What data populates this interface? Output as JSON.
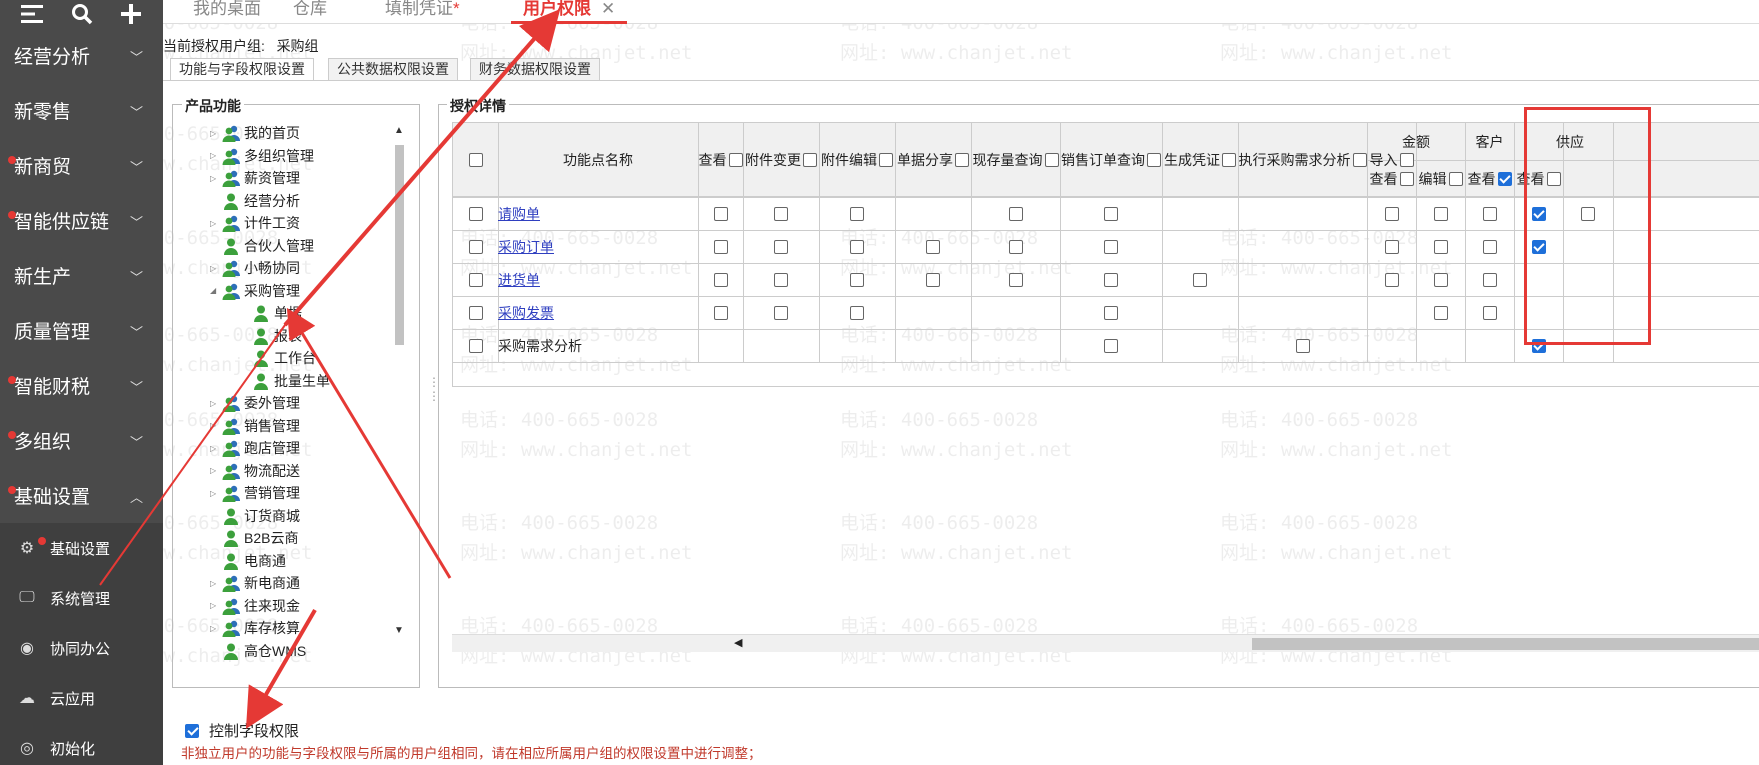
{
  "sidebar": {
    "items": [
      {
        "label": "经营分析",
        "dot": false,
        "chevron": "﹀"
      },
      {
        "label": "新零售",
        "dot": false,
        "chevron": "﹀"
      },
      {
        "label": "新商贸",
        "dot": true,
        "chevron": "﹀"
      },
      {
        "label": "智能供应链",
        "dot": true,
        "chevron": "﹀"
      },
      {
        "label": "新生产",
        "dot": false,
        "chevron": "﹀"
      },
      {
        "label": "质量管理",
        "dot": false,
        "chevron": "﹀"
      },
      {
        "label": "智能财税",
        "dot": true,
        "chevron": "﹀"
      },
      {
        "label": "多组织",
        "dot": true,
        "chevron": "﹀"
      },
      {
        "label": "基础设置",
        "dot": true,
        "chevron": "︿"
      }
    ],
    "sub_items": [
      {
        "label": "基础设置",
        "icon": "gear-icon",
        "dot": true
      },
      {
        "label": "系统管理",
        "icon": "monitor-icon",
        "dot": false
      },
      {
        "label": "协同办公",
        "icon": "chat-icon",
        "dot": false
      },
      {
        "label": "云应用",
        "icon": "cloud-icon",
        "dot": false
      },
      {
        "label": "初始化",
        "icon": "initialize-icon",
        "dot": false
      }
    ]
  },
  "tabs": [
    {
      "label": "我的桌面",
      "modified": ""
    },
    {
      "label": "仓库",
      "modified": ""
    },
    {
      "label": "填制凭证",
      "modified": "*"
    },
    {
      "label": "用户权限",
      "modified": "",
      "close": "✕"
    }
  ],
  "group": {
    "label": "当前授权用户组:",
    "value": "采购组"
  },
  "subtabs": [
    "功能与字段权限设置",
    "公共数据权限设置",
    "财务数据权限设置"
  ],
  "product_function": {
    "title": "产品功能",
    "items": [
      {
        "label": "我的首页",
        "expand": "▷",
        "icon": "group"
      },
      {
        "label": "多组织管理",
        "expand": "▷",
        "icon": "group"
      },
      {
        "label": "薪资管理",
        "expand": "▷",
        "icon": "group"
      },
      {
        "label": "经营分析",
        "expand": "",
        "icon": "user"
      },
      {
        "label": "计件工资",
        "expand": "▷",
        "icon": "group"
      },
      {
        "label": "合伙人管理",
        "expand": "",
        "icon": "user"
      },
      {
        "label": "小畅协同",
        "expand": "▷",
        "icon": "group"
      },
      {
        "label": "采购管理",
        "expand": "◢",
        "icon": "group"
      },
      {
        "label": "单据",
        "expand": "",
        "icon": "user",
        "indent": 1
      },
      {
        "label": "报表",
        "expand": "",
        "icon": "user",
        "indent": 1
      },
      {
        "label": "工作台",
        "expand": "",
        "icon": "user",
        "indent": 1
      },
      {
        "label": "批量生单",
        "expand": "",
        "icon": "user",
        "indent": 1
      },
      {
        "label": "委外管理",
        "expand": "▷",
        "icon": "group"
      },
      {
        "label": "销售管理",
        "expand": "▷",
        "icon": "group"
      },
      {
        "label": "跑店管理",
        "expand": "▷",
        "icon": "group"
      },
      {
        "label": "物流配送",
        "expand": "▷",
        "icon": "group"
      },
      {
        "label": "营销管理",
        "expand": "▷",
        "icon": "group"
      },
      {
        "label": "订货商城",
        "expand": "",
        "icon": "user"
      },
      {
        "label": "B2B云商",
        "expand": "",
        "icon": "user"
      },
      {
        "label": "电商通",
        "expand": "",
        "icon": "user"
      },
      {
        "label": "新电商通",
        "expand": "▷",
        "icon": "group"
      },
      {
        "label": "往来现金",
        "expand": "▷",
        "icon": "group"
      },
      {
        "label": "库存核算",
        "expand": "▷",
        "icon": "group"
      },
      {
        "label": "高仓WMS",
        "expand": "",
        "icon": "user"
      }
    ]
  },
  "auth": {
    "title": "授权详情",
    "name_header": "功能点名称",
    "headers": [
      "查看",
      "附件变更",
      "附件编辑",
      "单据分享",
      "现存量查询",
      "销售订单查询",
      "生成凭证",
      "执行采购需求分析",
      "导入"
    ],
    "group_amount": "金额",
    "group_customer": "客户",
    "group_supplier": "供应",
    "amount_sub": [
      "查看",
      "编辑"
    ],
    "customer_sub": [
      "查看"
    ],
    "supplier_sub": [
      "查看"
    ],
    "rows": [
      {
        "name": "请购单",
        "link": true,
        "cells": [
          1,
          1,
          1,
          0,
          1,
          1,
          0,
          0,
          1,
          1,
          1,
          2,
          1
        ]
      },
      {
        "name": "采购订单",
        "link": true,
        "cells": [
          1,
          1,
          1,
          1,
          1,
          1,
          0,
          0,
          1,
          1,
          1,
          2,
          0
        ]
      },
      {
        "name": "进货单",
        "link": true,
        "cells": [
          1,
          1,
          1,
          1,
          1,
          1,
          1,
          0,
          1,
          1,
          1,
          0,
          0
        ]
      },
      {
        "name": "采购发票",
        "link": true,
        "cells": [
          1,
          1,
          1,
          0,
          0,
          1,
          0,
          0,
          0,
          1,
          1,
          0,
          0
        ]
      },
      {
        "name": "采购需求分析",
        "link": false,
        "cells": [
          0,
          0,
          0,
          0,
          0,
          1,
          0,
          1,
          0,
          0,
          0,
          2,
          0
        ]
      }
    ]
  },
  "control_field": {
    "label": "控制字段权限",
    "checked": true
  },
  "note": "非独立用户的功能与字段权限与所属的用户组相同，请在相应所属用户组的权限设置中进行调整；",
  "watermark": {
    "phone": "电话: 400-665-0028",
    "site": "网址: www.chanjet.net"
  },
  "colors": {
    "accent_red": "#e53935",
    "sidebar_bg": "#4a4a4a",
    "link_blue": "#2f3fc0",
    "check_blue": "#1e6fd9"
  }
}
